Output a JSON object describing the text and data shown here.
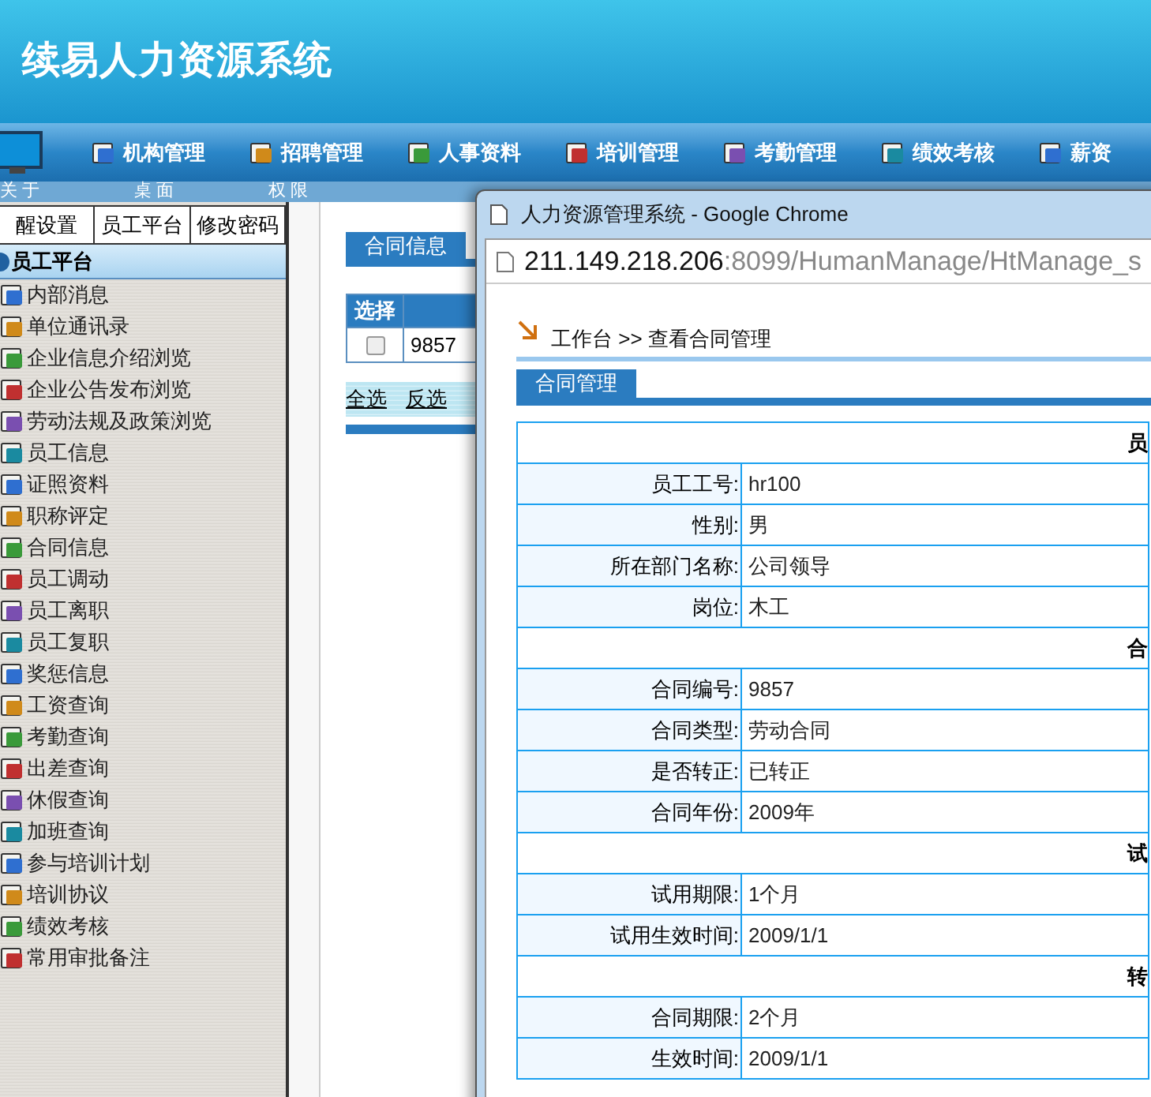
{
  "header": {
    "title": "续易人力资源系统"
  },
  "nav": {
    "items": [
      "机构管理",
      "招聘管理",
      "人事资料",
      "培训管理",
      "考勤管理",
      "绩效考核",
      "薪资"
    ]
  },
  "subbar": {
    "items": [
      "关 于",
      "桌 面",
      "权 限"
    ]
  },
  "sidebar": {
    "tabs": [
      "醒设置",
      "员工平台",
      "修改密码"
    ],
    "section": "员工平台",
    "items": [
      "内部消息",
      "单位通讯录",
      "企业信息介绍浏览",
      "企业公告发布浏览",
      "劳动法规及政策浏览",
      "员工信息",
      "证照资料",
      "职称评定",
      "合同信息",
      "员工调动",
      "员工离职",
      "员工复职",
      "奖惩信息",
      "工资查询",
      "考勤查询",
      "出差查询",
      "休假查询",
      "加班查询",
      "参与培训计划",
      "培训协议",
      "绩效考核",
      "常用审批备注"
    ]
  },
  "main": {
    "tab": "合同信息",
    "columns": [
      "选择"
    ],
    "rows": [
      {
        "checked": false,
        "cells": [
          "9857"
        ]
      }
    ],
    "links": [
      "全选",
      "反选"
    ]
  },
  "popup": {
    "title": "人力资源管理系统 - Google Chrome",
    "url_host": "211.149.218.206",
    "url_rest": ":8099/HumanManage/HtManage_s",
    "breadcrumb": "工作台 >> 查看合同管理",
    "tab": "合同管理",
    "sections": [
      {
        "title": "员",
        "rows": [
          {
            "label": "员工工号:",
            "value": "hr100"
          },
          {
            "label": "性别:",
            "value": "男"
          },
          {
            "label": "所在部门名称:",
            "value": "公司领导"
          },
          {
            "label": "岗位:",
            "value": "木工"
          }
        ]
      },
      {
        "title": "合",
        "rows": [
          {
            "label": "合同编号:",
            "value": "9857"
          },
          {
            "label": "合同类型:",
            "value": "劳动合同"
          },
          {
            "label": "是否转正:",
            "value": "已转正"
          },
          {
            "label": "合同年份:",
            "value": "2009年"
          }
        ]
      },
      {
        "title": "试",
        "rows": [
          {
            "label": "试用期限:",
            "value": "1个月"
          },
          {
            "label": "试用生效时间:",
            "value": "2009/1/1"
          }
        ]
      },
      {
        "title": "转",
        "rows": [
          {
            "label": "合同期限:",
            "value": "2个月"
          },
          {
            "label": "生效时间:",
            "value": "2009/1/1"
          }
        ]
      }
    ]
  }
}
